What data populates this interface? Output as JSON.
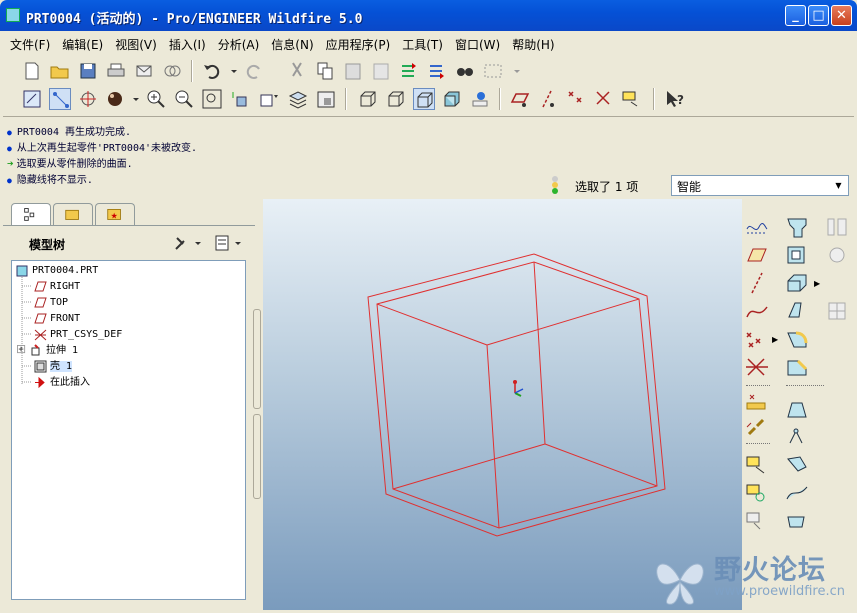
{
  "window": {
    "title": "PRT0004 (活动的) - Pro/ENGINEER Wildfire 5.0",
    "min": "_",
    "max": "□",
    "close": "✕"
  },
  "menu": [
    "文件(F)",
    "编辑(E)",
    "视图(V)",
    "插入(I)",
    "分析(A)",
    "信息(N)",
    "应用程序(P)",
    "工具(T)",
    "窗口(W)",
    "帮助(H)"
  ],
  "messages": [
    {
      "icon": "bullet",
      "text": "PRT0004 再生成功完成."
    },
    {
      "icon": "bullet",
      "text": "从上次再生起零件'PRT0004'未被改变."
    },
    {
      "icon": "arrow",
      "text": "选取要从零件删除的曲面."
    },
    {
      "icon": "bullet",
      "text": "隐藏线将不显示."
    }
  ],
  "status": {
    "selection": "选取了 1 项",
    "filter": "智能"
  },
  "model_tree": {
    "title": "模型树",
    "items": [
      {
        "label": "PRT0004.PRT",
        "icon": "part-icon",
        "level": 0
      },
      {
        "label": "RIGHT",
        "icon": "datum-plane-icon",
        "level": 1
      },
      {
        "label": "TOP",
        "icon": "datum-plane-icon",
        "level": 1
      },
      {
        "label": "FRONT",
        "icon": "datum-plane-icon",
        "level": 1
      },
      {
        "label": "PRT_CSYS_DEF",
        "icon": "csys-icon",
        "level": 1
      },
      {
        "label": "拉伸 1",
        "icon": "extrude-icon",
        "level": 1,
        "expandable": true
      },
      {
        "label": "壳 1",
        "icon": "shell-icon",
        "level": 1,
        "selected": true
      },
      {
        "label": "在此插入",
        "icon": "insert-here-icon",
        "level": 1
      }
    ]
  },
  "watermark": {
    "name": "野火论坛",
    "url": "www.proewildfire.cn"
  },
  "colors": {
    "title": "#0551d6",
    "model_edge": "#e03030",
    "viewport_top": "#e8f0f6",
    "viewport_bottom": "#7a9bbd"
  }
}
